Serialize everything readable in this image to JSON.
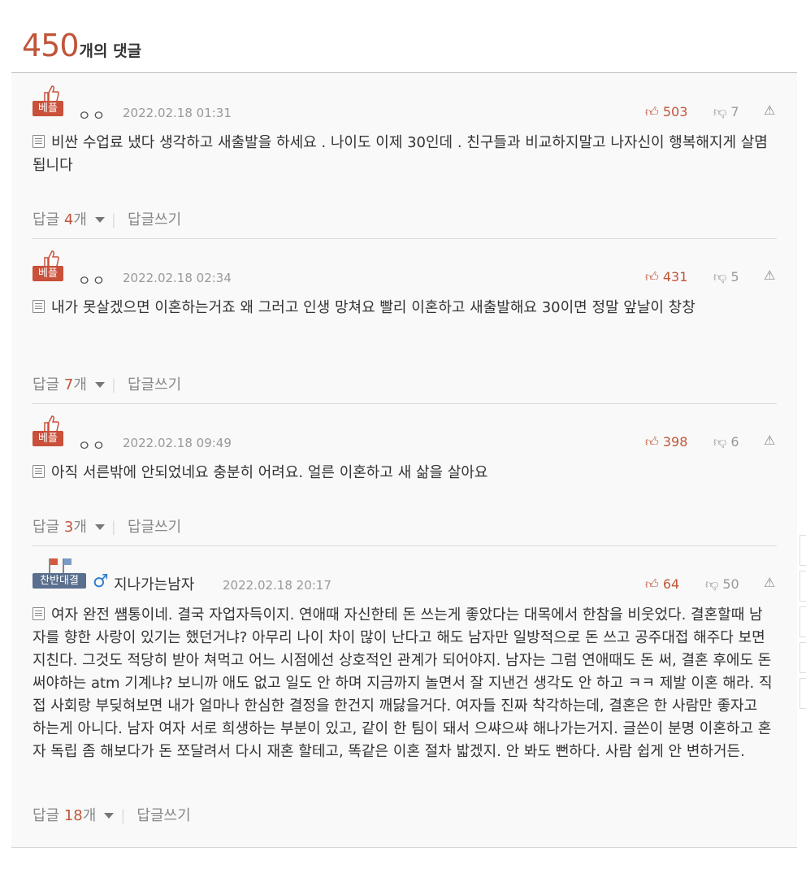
{
  "header": {
    "count": "450",
    "label": "개의 댓글"
  },
  "colors": {
    "accent": "#c0553a",
    "best_badge": "#c9503a",
    "dual_badge": "#5a6f8e",
    "gender_male": "#2d7ed0"
  },
  "comments": [
    {
      "badge": "베플",
      "badge_icon": "thumbs-up-icon",
      "nickname": "ㅇㅇ",
      "date": "2022.02.18 01:31",
      "upvotes": "503",
      "downvotes": "7",
      "body": "비싼 수업료 냈다 생각하고 새출발을 하세요 . 나이도 이제 30인데 . 친구들과 비교하지말고 나자신이 행복해지게 살몀 됩니다",
      "reply_label": "답글",
      "reply_count": "4",
      "reply_unit": "개",
      "write_reply": "답글쓰기"
    },
    {
      "badge": "베플",
      "badge_icon": "thumbs-up-icon",
      "nickname": "ㅇㅇ",
      "date": "2022.02.18 02:34",
      "upvotes": "431",
      "downvotes": "5",
      "body": "내가 못살겠으면 이혼하는거죠 왜 그러고 인생 망쳐요 빨리 이혼하고 새출발해요 30이면 정말 앞날이 창창",
      "reply_label": "답글",
      "reply_count": "7",
      "reply_unit": "개",
      "write_reply": "답글쓰기"
    },
    {
      "badge": "베플",
      "badge_icon": "thumbs-up-icon",
      "nickname": "ㅇㅇ",
      "date": "2022.02.18 09:49",
      "upvotes": "398",
      "downvotes": "6",
      "body": "아직 서른밖에 안되었네요 충분히 어려요. 얼른 이혼하고 새 삶을 살아요",
      "reply_label": "답글",
      "reply_count": "3",
      "reply_unit": "개",
      "write_reply": "답글쓰기"
    },
    {
      "badge": "찬반대결",
      "badge_icon": "flags-icon",
      "gender_icon": "male-icon",
      "nickname": "지나가는남자",
      "date": "2022.02.18 20:17",
      "upvotes": "64",
      "downvotes": "50",
      "body": "여자 완전 썜통이네. 결국 자업자득이지. 연애때 자신한테 돈 쓰는게 좋았다는 대목에서 한참을 비웃었다. 결혼할때 남자를 향한 사랑이 있기는 했던거냐? 아무리 나이 차이 많이 난다고 해도 남자만 일방적으로 돈 쓰고 공주대접 해주다 보면 지친다. 그것도 적당히 받아 쳐먹고 어느 시점에선 상호적인 관계가 되어야지. 남자는 그럼 연애때도 돈 써, 결혼 후에도 돈 써야하는 atm 기계냐? 보니까 애도 없고 일도 안 하며 지금까지 놀면서 잘 지낸건 생각도 안 하고 ㅋㅋ 제발 이혼 해라. 직접 사회랑 부딪혀보면 내가 얼마나 한심한 결정을 한건지 깨닳을거다. 여자들 진짜 착각하는데, 결혼은 한 사람만 좋자고 하는게 아니다. 남자 여자 서로 희생하는 부분이 있고, 같이 한 팀이 돼서 으쌰으쌰 해나가는거지. 글쓴이 분명 이혼하고 혼자 독립 좀 해보다가 돈 쪼달려서 다시 재혼 할테고, 똑같은 이혼 절차 밟겠지. 안 봐도 뻔하다. 사람 쉽게 안 변하거든.",
      "reply_label": "답글",
      "reply_count": "18",
      "reply_unit": "개",
      "write_reply": "답글쓰기"
    }
  ]
}
